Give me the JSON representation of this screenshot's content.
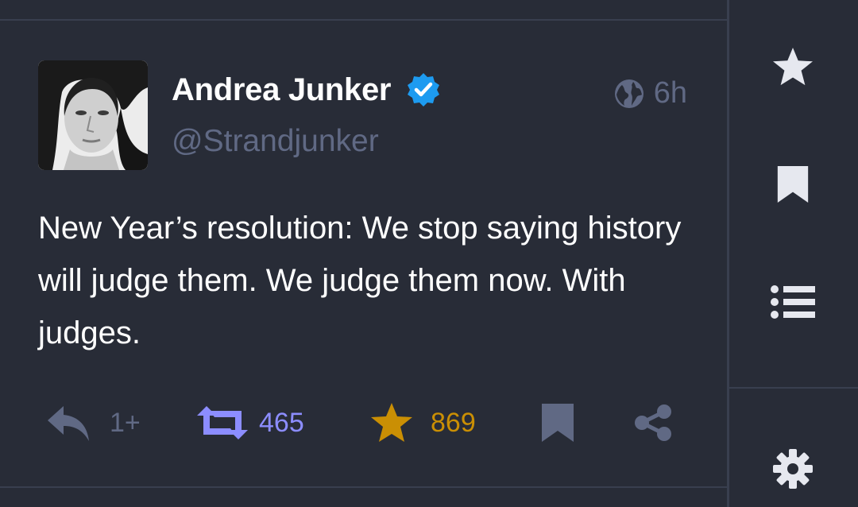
{
  "status": {
    "display_name": "Andrea Junker",
    "handle": "@Strandjunker",
    "verified": true,
    "visibility_icon": "globe-icon",
    "timestamp": "6h",
    "content": "New Year’s resolution: We stop saying history will judge them. We judge them now. With judges.",
    "actions": {
      "reply_count": "1+",
      "boost_count": "465",
      "favourite_count": "869"
    }
  },
  "rail": {
    "icons": [
      "star-icon",
      "bookmark-icon",
      "list-icon",
      "gear-icon"
    ]
  },
  "colors": {
    "background": "#282c37",
    "divider": "#393f4f",
    "muted": "#606984",
    "boost": "#8c8dff",
    "favourite": "#ca8f04",
    "verified": "#1d9bf0",
    "rail_icon": "#e6e8ef"
  }
}
